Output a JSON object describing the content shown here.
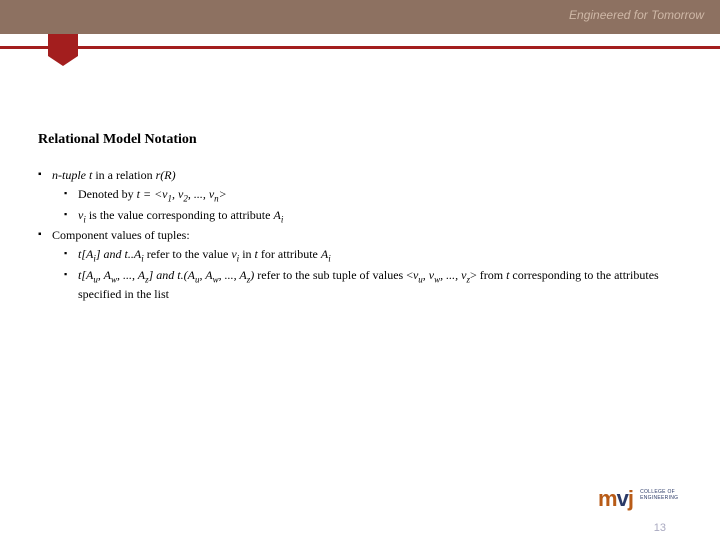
{
  "header": {
    "tagline": "Engineered for Tomorrow"
  },
  "slide": {
    "title": "Relational Model Notation",
    "b1_i1_pre": "n-tuple t",
    "b1_i1_post": " in a relation ",
    "b1_i1_r": "r(R)",
    "b2_i1_pre": "Denoted by ",
    "b2_i1_mid": "t = <v",
    "b2_i1_s1": "1",
    "b2_i1_c1": ", v",
    "b2_i1_s2": "2",
    "b2_i1_c2": ", ..., v",
    "b2_i1_sn": "n",
    "b2_i1_end": ">",
    "b2_i2_v": "v",
    "b2_i2_si": "i",
    "b2_i2_mid": " is the value corresponding to attribute ",
    "b2_i2_a": "A",
    "b2_i2_ai": "i",
    "b1_i2": "Component values of tuples:",
    "b2_i3_p1": "t[A",
    "b2_i3_s1": "i",
    "b2_i3_p2": "] and ",
    "b2_i3_p3": "t..A",
    "b2_i3_s3": "i",
    "b2_i3_p4": " refer to the value ",
    "b2_i3_p5": "v",
    "b2_i3_s5": "i",
    "b2_i3_p6": " in ",
    "b2_i3_p7": "t",
    "b2_i3_p8": " for attribute ",
    "b2_i3_p9": "A",
    "b2_i3_s9": "i",
    "b2_i4_a": "t[A",
    "b2_i4_su": "u",
    "b2_i4_b": ", A",
    "b2_i4_sw": "w",
    "b2_i4_c": ", ..., A",
    "b2_i4_sz": "z",
    "b2_i4_d": "] and ",
    "b2_i4_e": "t.(A",
    "b2_i4_su2": "u",
    "b2_i4_f": ", A",
    "b2_i4_sw2": "w",
    "b2_i4_g": ", ..., A",
    "b2_i4_sz2": "z",
    "b2_i4_h": ")",
    "b2_i4_i": " refer to the sub tuple of values <",
    "b2_i4_j": "v",
    "b2_i4_su3": "u",
    "b2_i4_k": ", v",
    "b2_i4_sw3": "w",
    "b2_i4_l": ", ..., v",
    "b2_i4_sz3": "z",
    "b2_i4_m": "> from ",
    "b2_i4_n": "t",
    "b2_i4_o": " corresponding to the attributes specified in the list"
  },
  "footer": {
    "logo_main_m": "m",
    "logo_main_v": "v",
    "logo_main_j": "j",
    "logo_sub1": "COLLEGE OF",
    "logo_sub2": "ENGINEERING",
    "page_number": "13"
  }
}
